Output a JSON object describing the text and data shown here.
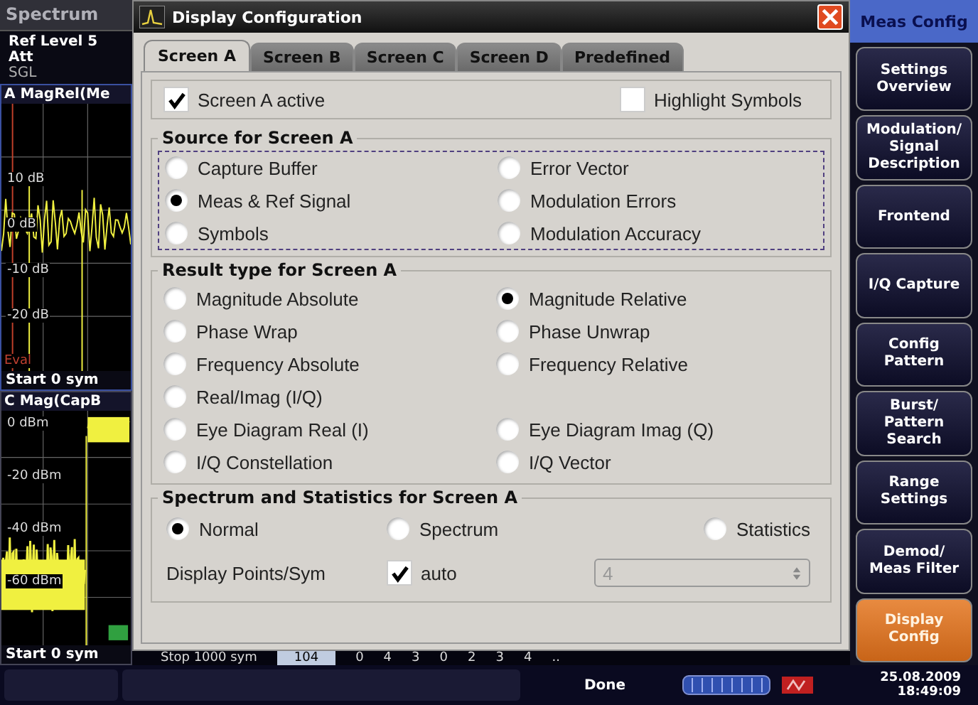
{
  "background": {
    "tab": "Spectrum",
    "info": [
      "Ref Level 5",
      "Att",
      "SGL"
    ],
    "panes": [
      {
        "title": "A MagRel(Me",
        "y_labels": [
          "10 dB",
          "0 dB",
          "-10 dB",
          "-20 dB"
        ],
        "marker": "Eval",
        "footer": "Start 0 sym"
      },
      {
        "title": "C Mag(CapB",
        "y_labels": [
          "0 dBm",
          "-20 dBm",
          "-40 dBm",
          "-60 dBm"
        ],
        "footer": "Start 0 sym"
      }
    ],
    "strip": {
      "stop": "Stop 1000 sym",
      "value": "104",
      "cells": [
        "0",
        "4",
        "3",
        "0",
        "2",
        "3",
        "4",
        ".."
      ]
    }
  },
  "dialog": {
    "title": "Display Configuration",
    "tabs": [
      {
        "label": "Screen A",
        "selected": true
      },
      {
        "label": "Screen B",
        "selected": false
      },
      {
        "label": "Screen C",
        "selected": false
      },
      {
        "label": "Screen D",
        "selected": false
      },
      {
        "label": "Predefined",
        "selected": false
      }
    ],
    "screen_active": {
      "label": "Screen A active",
      "checked": true
    },
    "highlight_symbols": {
      "label": "Highlight Symbols",
      "checked": false
    },
    "source": {
      "title": "Source for Screen A",
      "rows": [
        [
          {
            "label": "Capture Buffer",
            "selected": false
          },
          {
            "label": "Error Vector",
            "selected": false
          }
        ],
        [
          {
            "label": "Meas & Ref Signal",
            "selected": true
          },
          {
            "label": "Modulation Errors",
            "selected": false
          }
        ],
        [
          {
            "label": "Symbols",
            "selected": false
          },
          {
            "label": "Modulation Accuracy",
            "selected": false
          }
        ]
      ]
    },
    "result_type": {
      "title": "Result type for Screen A",
      "rows": [
        [
          {
            "label": "Magnitude Absolute",
            "selected": false
          },
          {
            "label": "Magnitude Relative",
            "selected": true
          }
        ],
        [
          {
            "label": "Phase Wrap",
            "selected": false
          },
          {
            "label": "Phase Unwrap",
            "selected": false
          }
        ],
        [
          {
            "label": "Frequency Absolute",
            "selected": false
          },
          {
            "label": "Frequency Relative",
            "selected": false
          }
        ],
        [
          {
            "label": "Real/Imag (I/Q)",
            "selected": false
          }
        ],
        [
          {
            "label": "Eye Diagram Real (I)",
            "selected": false
          },
          {
            "label": "Eye Diagram Imag (Q)",
            "selected": false
          }
        ],
        [
          {
            "label": "I/Q Constellation",
            "selected": false
          },
          {
            "label": "I/Q Vector",
            "selected": false
          }
        ]
      ]
    },
    "spectrum": {
      "title": "Spectrum and Statistics for Screen A",
      "options": [
        {
          "label": "Normal",
          "selected": true
        },
        {
          "label": "Spectrum",
          "selected": false
        },
        {
          "label": "Statistics",
          "selected": false
        }
      ],
      "points_label": "Display Points/Sym",
      "auto": {
        "label": "auto",
        "checked": true
      },
      "points_value": "4",
      "points_disabled": true
    }
  },
  "softkeys": {
    "title": "Meas Config",
    "items": [
      {
        "label": "Settings\nOverview",
        "selected": false
      },
      {
        "label": "Modulation/\nSignal\nDescription",
        "selected": false
      },
      {
        "label": "Frontend",
        "selected": false
      },
      {
        "label": "I/Q Capture",
        "selected": false
      },
      {
        "label": "Config\nPattern",
        "selected": false
      },
      {
        "label": "Burst/\nPattern\nSearch",
        "selected": false
      },
      {
        "label": "Range\nSettings",
        "selected": false
      },
      {
        "label": "Demod/\nMeas Filter",
        "selected": false
      },
      {
        "label": "Display\nConfig",
        "selected": true
      }
    ]
  },
  "status_bar": {
    "message": "Done",
    "date": "25.08.2009",
    "time": "18:49:09"
  }
}
